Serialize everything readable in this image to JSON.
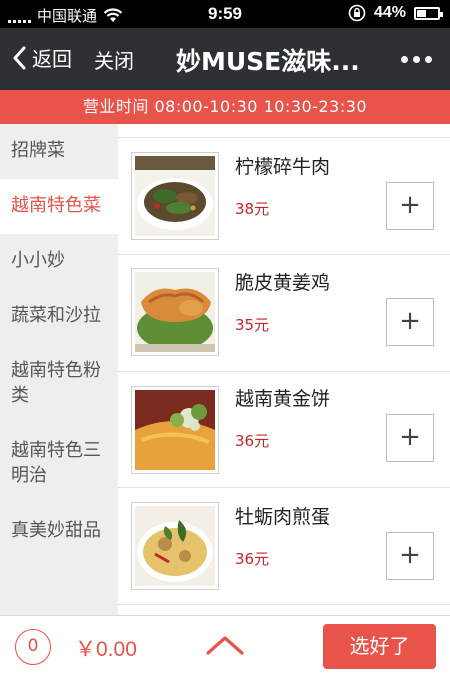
{
  "status_bar": {
    "carrier": "中国联通",
    "wifi_icon": "wifi-icon",
    "time": "9:59",
    "orientation_lock_icon": "rotation-lock-icon",
    "battery_percent_label": "44%",
    "battery_level": 0.44
  },
  "nav": {
    "back_label": "返回",
    "close_label": "关闭",
    "title": "妙MUSE滋味...",
    "more_icon": "more-dots-icon"
  },
  "hours_banner": "营业时间 08:00-10:30 10:30-23:30",
  "sidebar": {
    "categories": [
      {
        "label": "招牌菜"
      },
      {
        "label": "越南特色菜"
      },
      {
        "label": "小小妙"
      },
      {
        "label": "蔬菜和沙拉"
      },
      {
        "label": "越南特色粉类"
      },
      {
        "label": "越南特色三明治"
      },
      {
        "label": "真美妙甜品"
      }
    ],
    "active_index": 1
  },
  "menu": {
    "items": [
      {
        "name": "柠檬碎牛肉",
        "price": "38元",
        "add_label": "+"
      },
      {
        "name": "脆皮黄姜鸡",
        "price": "35元",
        "add_label": "+"
      },
      {
        "name": "越南黄金饼",
        "price": "36元",
        "add_label": "+"
      },
      {
        "name": "牡蛎肉煎蛋",
        "price": "36元",
        "add_label": "+"
      }
    ]
  },
  "bottom_bar": {
    "cart_count": "0",
    "total": "￥0.00",
    "expand_icon": "chevron-up-icon",
    "submit_label": "选好了"
  },
  "colors": {
    "accent": "#e8534a",
    "price": "#c2272d",
    "navbar": "#2d3034",
    "sidebar_bg": "#eeeeee"
  }
}
